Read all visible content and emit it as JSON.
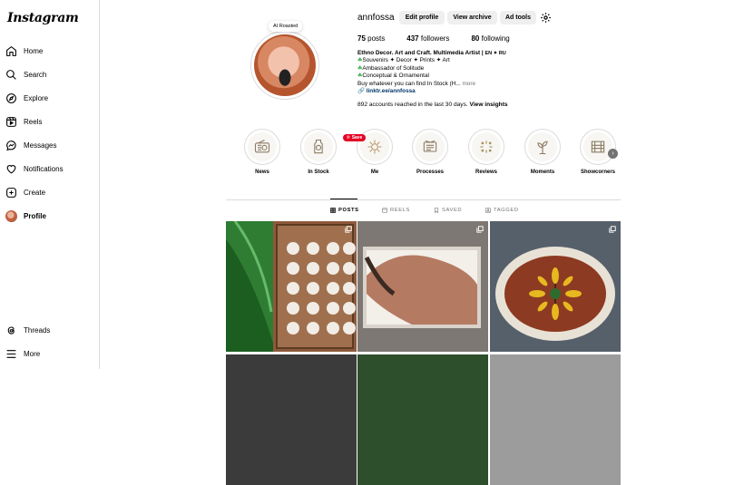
{
  "app": {
    "logo": "Instagram"
  },
  "sidebar": {
    "items": [
      {
        "label": "Home",
        "icon": "home-icon"
      },
      {
        "label": "Search",
        "icon": "search-icon"
      },
      {
        "label": "Explore",
        "icon": "compass-icon"
      },
      {
        "label": "Reels",
        "icon": "reels-icon"
      },
      {
        "label": "Messages",
        "icon": "messenger-icon"
      },
      {
        "label": "Notifications",
        "icon": "heart-icon"
      },
      {
        "label": "Create",
        "icon": "plus-square-icon"
      },
      {
        "label": "Profile",
        "icon": "avatar"
      }
    ],
    "bottom": [
      {
        "label": "Threads",
        "icon": "threads-icon"
      },
      {
        "label": "More",
        "icon": "menu-icon"
      }
    ]
  },
  "profile": {
    "note": "AI Roasted",
    "username": "annfossa",
    "buttons": {
      "edit": "Edit profile",
      "archive": "View archive",
      "adtools": "Ad tools"
    },
    "stats": {
      "posts_num": "75",
      "posts_label": "posts",
      "followers_num": "437",
      "followers_label": "followers",
      "following_num": "80",
      "following_label": "following"
    },
    "bio": {
      "name": "Ethno Decor. Art and Craft. Multimedia Artist |",
      "langs": "EN ✦ RU",
      "line1": "Souvenirs ✦ Decor ✦ Prints ✦ Art",
      "line2": "Ambassador of Solitude",
      "line3": "Conceptual & Ornamental",
      "line4": "Buy whatever you can find In Stock (H...",
      "more": "more",
      "link": "linktr.ee/annfossa"
    },
    "insights": {
      "text": "892 accounts reached in the last 30 days.",
      "action": "View insights"
    }
  },
  "highlights": [
    {
      "label": "News",
      "icon": "radio-icon"
    },
    {
      "label": "In Stock",
      "icon": "jar-icon"
    },
    {
      "label": "Me",
      "icon": "sun-ornament-icon"
    },
    {
      "label": "Processes",
      "icon": "notebook-icon"
    },
    {
      "label": "Reviews",
      "icon": "sparkle-icon"
    },
    {
      "label": "Moments",
      "icon": "plant-icon"
    },
    {
      "label": "Showcorners",
      "icon": "cabinet-icon"
    }
  ],
  "save_pill": "Save",
  "tabs": [
    {
      "label": "POSTS",
      "icon": "grid-icon",
      "active": true
    },
    {
      "label": "REELS",
      "icon": "reels-icon",
      "active": false
    },
    {
      "label": "SAVED",
      "icon": "bookmark-icon",
      "active": false
    },
    {
      "label": "TAGGED",
      "icon": "tag-icon",
      "active": false
    }
  ],
  "colors": {
    "link": "#00376b",
    "muted": "#737373",
    "border": "#dbdbdb",
    "save": "#e60023"
  }
}
